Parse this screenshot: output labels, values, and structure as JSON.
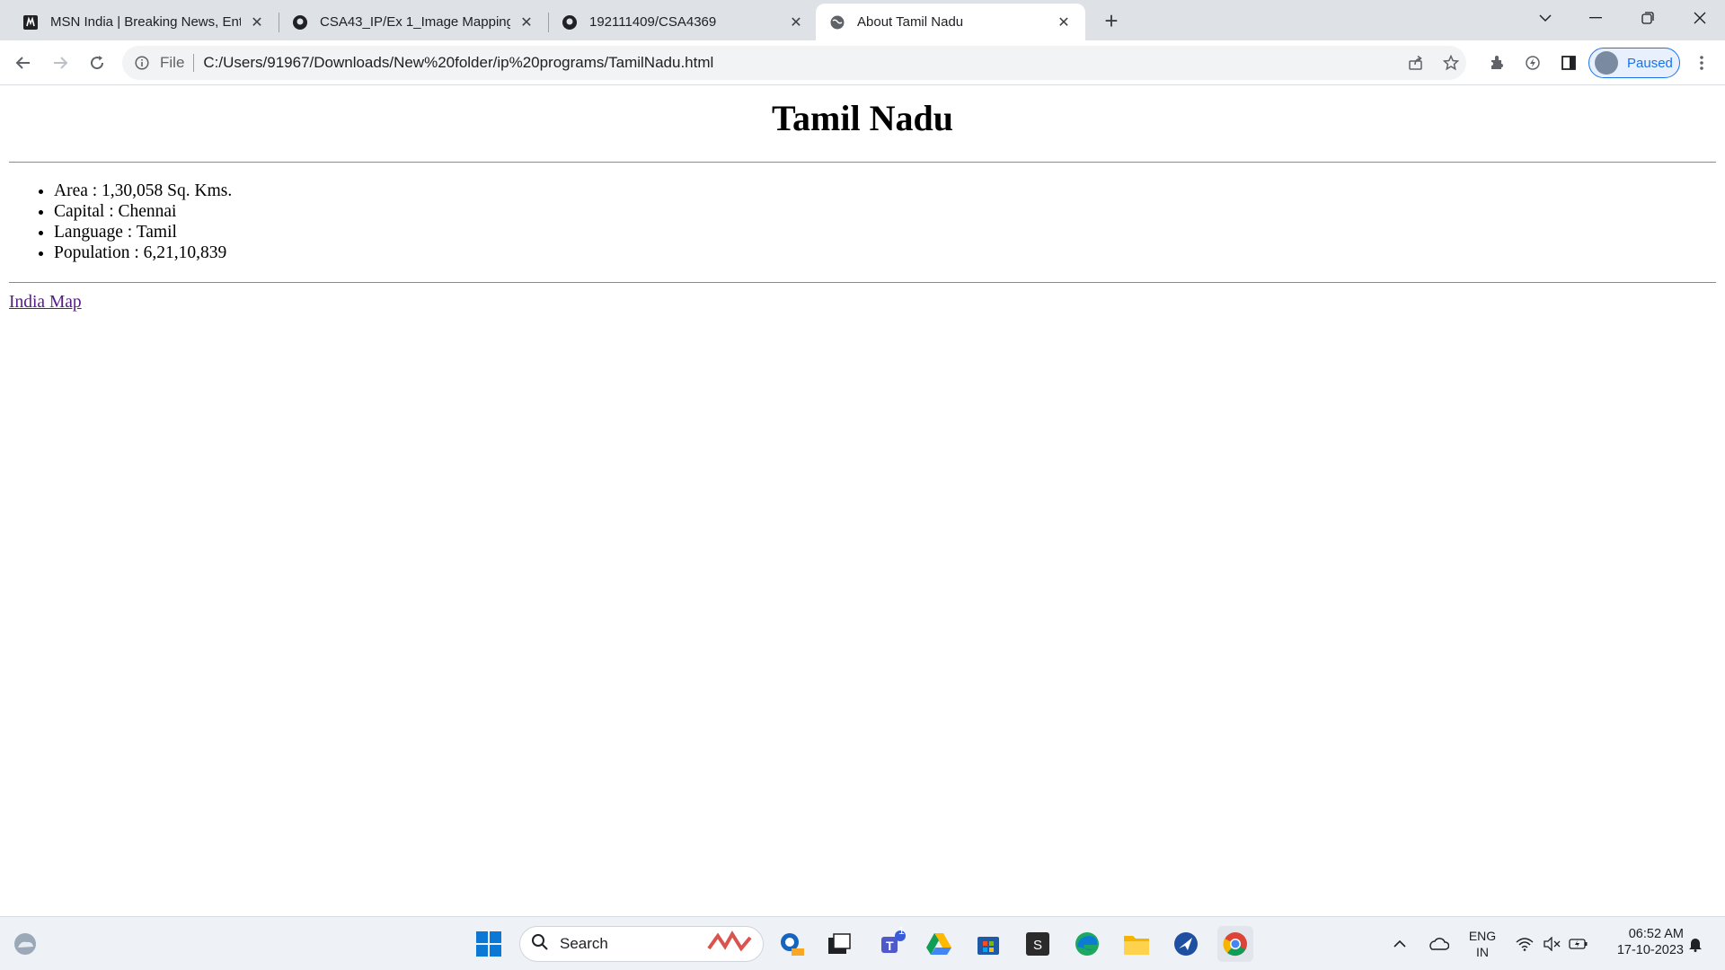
{
  "browser": {
    "tabs": [
      {
        "title": "MSN India | Breaking News, Ente",
        "icon": "msn-icon",
        "active": false
      },
      {
        "title": "CSA43_IP/Ex 1_Image Mapping.",
        "icon": "github-icon",
        "active": false
      },
      {
        "title": "192111409/CSA4369",
        "icon": "github-icon",
        "active": false
      },
      {
        "title": "About Tamil Nadu",
        "icon": "globe-icon",
        "active": true
      }
    ],
    "address": {
      "scheme_label": "File",
      "url": "C:/Users/91967/Downloads/New%20folder/ip%20programs/TamilNadu.html"
    },
    "profile_status": "Paused"
  },
  "page": {
    "heading": "Tamil Nadu",
    "facts": [
      "Area : 1,30,058 Sq. Kms.",
      "Capital : Chennai",
      "Language : Tamil",
      "Population : 6,21,10,839"
    ],
    "link_text": "India Map"
  },
  "taskbar": {
    "search_label": "Search",
    "teams_badge": "1",
    "language": "ENG",
    "region": "IN",
    "time": "06:52 AM",
    "date": "17-10-2023"
  },
  "colors": {
    "tabstrip": "#dee1e6",
    "link_visited": "#551a8b",
    "accent": "#1a73e8"
  }
}
